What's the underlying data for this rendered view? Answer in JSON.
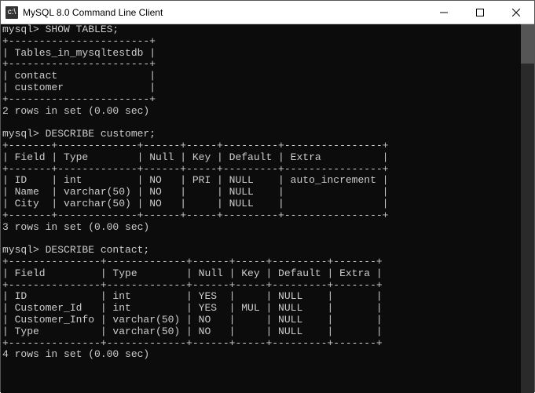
{
  "window": {
    "title": "MySQL 8.0 Command Line Client",
    "icon_label": "cmd"
  },
  "terminal": {
    "prompt": "mysql>",
    "commands": {
      "show_tables": "SHOW TABLES;",
      "describe_customer": "DESCRIBE customer;",
      "describe_contact": "DESCRIBE contact;"
    },
    "tables_result": {
      "header": "Tables_in_mysqltestdb",
      "rows": [
        "contact",
        "customer"
      ],
      "footer": "2 rows in set (0.00 sec)"
    },
    "customer_describe": {
      "headers": [
        "Field",
        "Type",
        "Null",
        "Key",
        "Default",
        "Extra"
      ],
      "rows": [
        {
          "field": "ID",
          "type": "int",
          "null": "NO",
          "key": "PRI",
          "default": "NULL",
          "extra": "auto_increment"
        },
        {
          "field": "Name",
          "type": "varchar(50)",
          "null": "NO",
          "key": "",
          "default": "NULL",
          "extra": ""
        },
        {
          "field": "City",
          "type": "varchar(50)",
          "null": "NO",
          "key": "",
          "default": "NULL",
          "extra": ""
        }
      ],
      "footer": "3 rows in set (0.00 sec)"
    },
    "contact_describe": {
      "headers": [
        "Field",
        "Type",
        "Null",
        "Key",
        "Default",
        "Extra"
      ],
      "rows": [
        {
          "field": "ID",
          "type": "int",
          "null": "YES",
          "key": "",
          "default": "NULL",
          "extra": ""
        },
        {
          "field": "Customer_Id",
          "type": "int",
          "null": "YES",
          "key": "MUL",
          "default": "NULL",
          "extra": ""
        },
        {
          "field": "Customer_Info",
          "type": "varchar(50)",
          "null": "NO",
          "key": "",
          "default": "NULL",
          "extra": ""
        },
        {
          "field": "Type",
          "type": "varchar(50)",
          "null": "NO",
          "key": "",
          "default": "NULL",
          "extra": ""
        }
      ],
      "footer": "4 rows in set (0.00 sec)"
    }
  }
}
